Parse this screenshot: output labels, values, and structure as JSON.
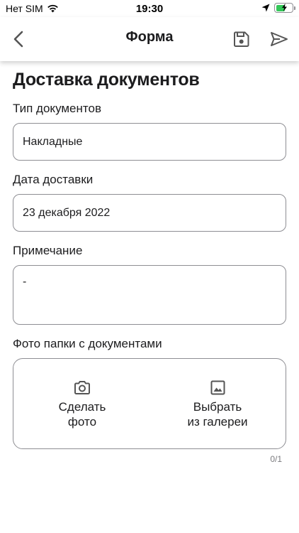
{
  "status_bar": {
    "carrier": "Нет SIM",
    "time": "19:30"
  },
  "nav": {
    "title": "Форма",
    "back_icon": "chevron-left-icon",
    "save_icon": "floppy-disk-icon",
    "send_icon": "paper-plane-icon"
  },
  "page": {
    "title": "Доставка документов"
  },
  "form": {
    "doc_type": {
      "label": "Тип документов",
      "value": "Накладные"
    },
    "delivery_date": {
      "label": "Дата доставки",
      "value": "23 декабря 2022"
    },
    "note": {
      "label": "Примечание",
      "value": "-"
    },
    "photo": {
      "label": "Фото папки с документами",
      "take_photo": "Сделать\nфото",
      "choose_gallery": "Выбрать\nиз галереи",
      "counter": "0/1"
    }
  },
  "colors": {
    "border": "#8e8e93",
    "battery": "#34c759",
    "text": "#1c1c1e"
  }
}
